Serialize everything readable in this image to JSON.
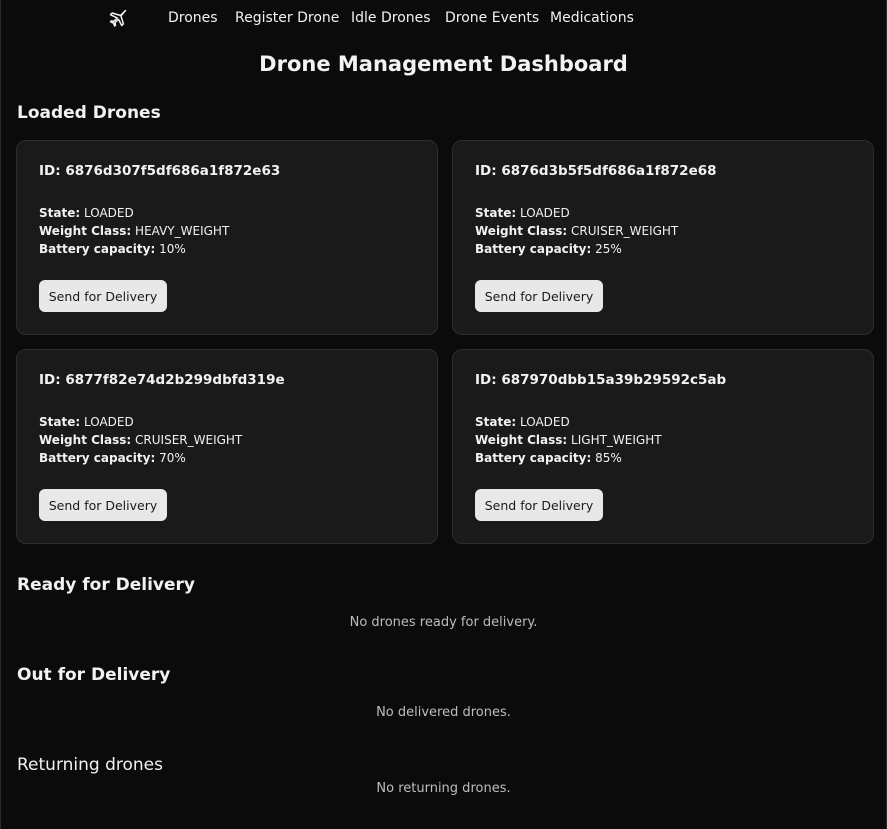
{
  "nav": {
    "logo_icon": "airplane-icon",
    "links": [
      "Drones",
      "Register Drone",
      "Idle Drones",
      "Drone Events",
      "Medications"
    ]
  },
  "page_title": "Drone Management Dashboard",
  "loaded": {
    "title": "Loaded Drones",
    "cards": [
      {
        "id": "6876d307f5df686a1f872e63",
        "state": "LOADED",
        "weight": "HEAVY_WEIGHT",
        "battery": "10%"
      },
      {
        "id": "6876d3b5f5df686a1f872e68",
        "state": "LOADED",
        "weight": "CRUISER_WEIGHT",
        "battery": "25%"
      },
      {
        "id": "6877f82e74d2b299dbfd319e",
        "state": "LOADED",
        "weight": "CRUISER_WEIGHT",
        "battery": "70%"
      },
      {
        "id": "687970dbb15a39b29592c5ab",
        "state": "LOADED",
        "weight": "LIGHT_WEIGHT",
        "battery": "85%"
      }
    ]
  },
  "labels": {
    "id": "ID:",
    "state": "State:",
    "weight": "Weight Class:",
    "battery": "Battery capacity:",
    "send_button": "Send for Delivery"
  },
  "ready": {
    "title": "Ready for Delivery",
    "empty": "No drones ready for delivery."
  },
  "out": {
    "title": "Out for Delivery",
    "empty": "No delivered drones."
  },
  "returning": {
    "title": "Returning drones",
    "empty": "No returning drones."
  }
}
